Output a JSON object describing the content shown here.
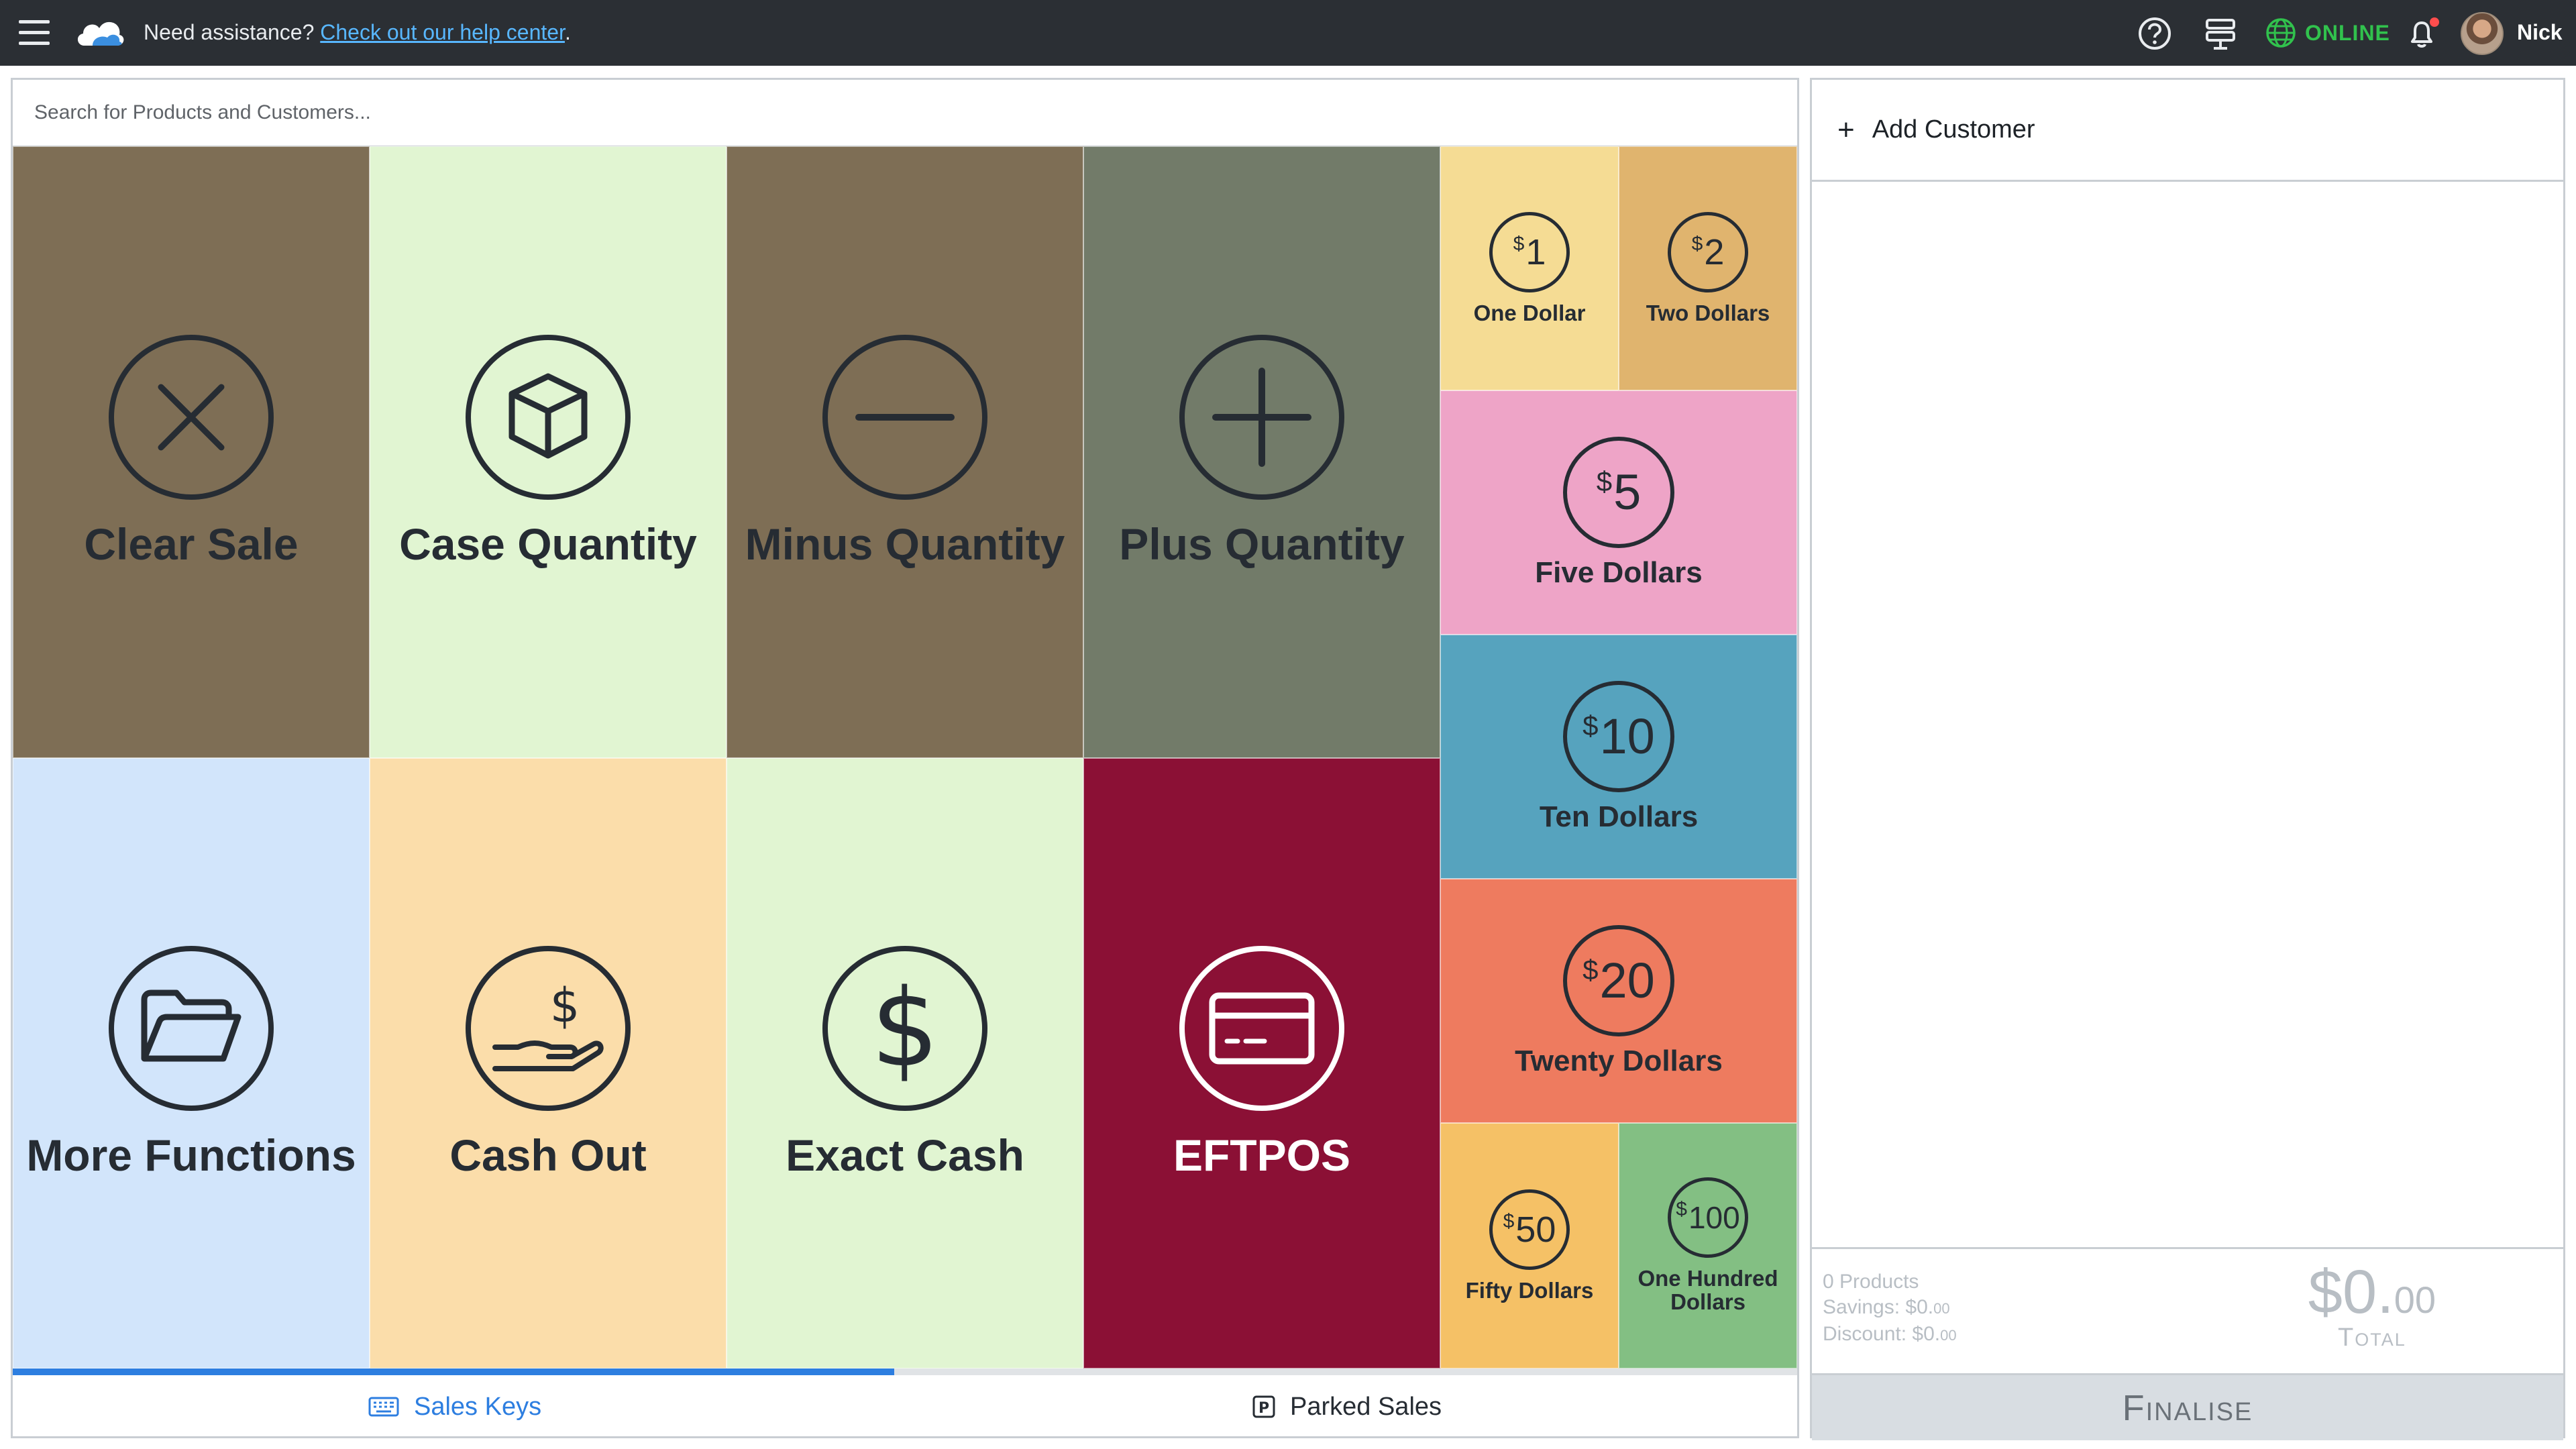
{
  "header": {
    "assist_text": "Need assistance?",
    "help_link": "Check out our help center",
    "help_suffix": ".",
    "status": "ONLINE",
    "status_color": "#31c24d",
    "user_name": "Nick",
    "icons": [
      "menu-icon",
      "cloud-logo",
      "help-icon",
      "register-icon",
      "globe-icon",
      "bell-icon"
    ]
  },
  "search": {
    "placeholder": "Search for Products and Customers..."
  },
  "keys": [
    {
      "label": "Clear Sale",
      "color": "#7e6e55",
      "icon": "close-circle-icon"
    },
    {
      "label": "Case Quantity",
      "color": "#e1f5d2",
      "icon": "box-icon"
    },
    {
      "label": "Minus Quantity",
      "color": "#7e6e55",
      "icon": "minus-icon"
    },
    {
      "label": "Plus Quantity",
      "color": "#727b69",
      "icon": "plus-icon"
    },
    {
      "label": "More Functions",
      "color": "#d2e5fb",
      "icon": "folder-icon"
    },
    {
      "label": "Cash Out",
      "color": "#fbddaa",
      "icon": "hand-dollar-icon"
    },
    {
      "label": "Exact Cash",
      "color": "#e1f5d2",
      "icon": "dollar-icon"
    },
    {
      "label": "EFTPOS",
      "color": "#8b1035",
      "icon": "card-icon"
    }
  ],
  "money": [
    {
      "label": "One Dollar",
      "value": "1",
      "color": "#f5dc94"
    },
    {
      "label": "Two Dollars",
      "value": "2",
      "color": "#e0b46e"
    },
    {
      "label": "Five Dollars",
      "value": "5",
      "color": "#eea4c7"
    },
    {
      "label": "Ten Dollars",
      "value": "10",
      "color": "#56a3be"
    },
    {
      "label": "Twenty Dollars",
      "value": "20",
      "color": "#ee7b5f"
    },
    {
      "label": "Fifty Dollars",
      "value": "50",
      "color": "#f5c166"
    },
    {
      "label": "One Hundred Dollars",
      "value": "100",
      "color": "#83bf83"
    }
  ],
  "tabs": {
    "sales": "Sales Keys",
    "parked": "Parked Sales"
  },
  "panel": {
    "add_customer": "Add Customer",
    "products": "0 Products",
    "savings_label": "Savings: $0.",
    "savings_cents": "00",
    "discount_label": "Discount: $0.",
    "discount_cents": "00",
    "total_amount": "$0.",
    "total_cents": "00",
    "total_label": "Total",
    "finalise": "Finalise"
  }
}
